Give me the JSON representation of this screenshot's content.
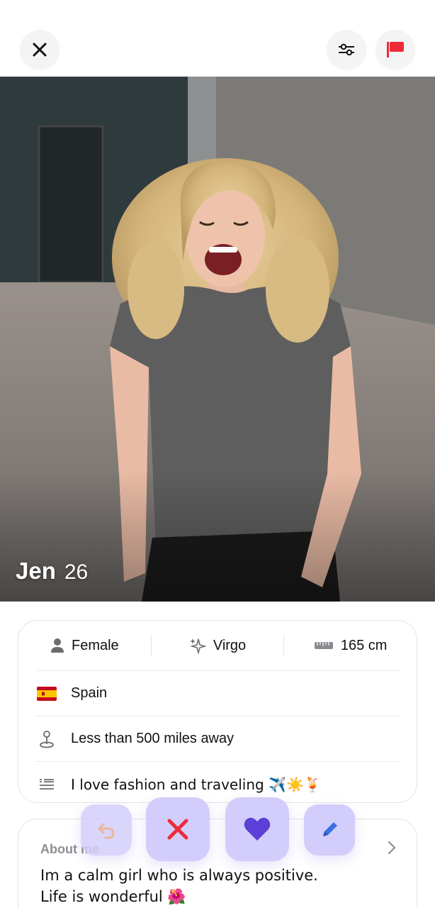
{
  "topbar": {
    "close_icon": "close-icon",
    "filter_icon": "sliders-icon",
    "report_icon": "flag-icon",
    "report_color": "#ef2b3a"
  },
  "profile": {
    "name": "Jen",
    "age": "26"
  },
  "stats": [
    {
      "icon": "person-icon",
      "label": "Female"
    },
    {
      "icon": "sparkle-icon",
      "label": "Virgo"
    },
    {
      "icon": "ruler-icon",
      "label": "165 cm"
    }
  ],
  "details": {
    "country": {
      "icon": "spain-flag-icon",
      "label": "Spain"
    },
    "distance": {
      "icon": "location-pin-icon",
      "label": "Less than 500 miles away"
    },
    "bio": {
      "icon": "quote-lines-icon",
      "label": "I love fashion and traveling ✈️☀️🍹"
    }
  },
  "about": {
    "title": "About me",
    "text_line1": "Im a calm girl who is always positive.",
    "text_line2": "Life is wonderful 🌺"
  },
  "actions": {
    "undo_icon": "undo-icon",
    "nope_icon": "x-icon",
    "like_icon": "heart-icon",
    "edit_icon": "pencil-icon",
    "nope_color": "#ef2b3a",
    "like_color": "#5b3fd6",
    "edit_color": "#3d6fe0",
    "button_bg": "#cdc6fa"
  }
}
